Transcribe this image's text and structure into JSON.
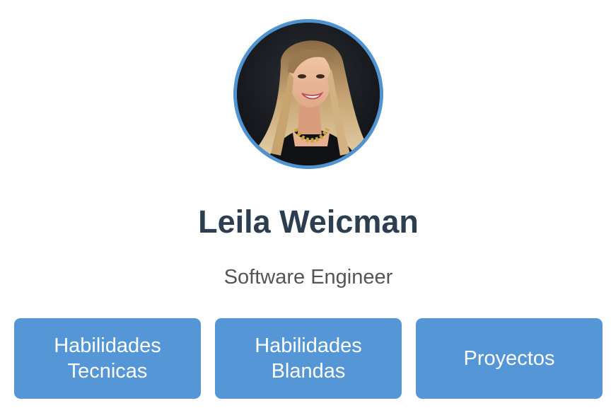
{
  "profile": {
    "name": "Leila Weicman",
    "role": "Software Engineer",
    "avatar_border_color": "#4f93d3"
  },
  "nav": {
    "buttons": [
      {
        "label": "Habilidades Tecnicas"
      },
      {
        "label": "Habilidades Blandas"
      },
      {
        "label": "Proyectos"
      }
    ],
    "button_color": "#5596d6"
  }
}
